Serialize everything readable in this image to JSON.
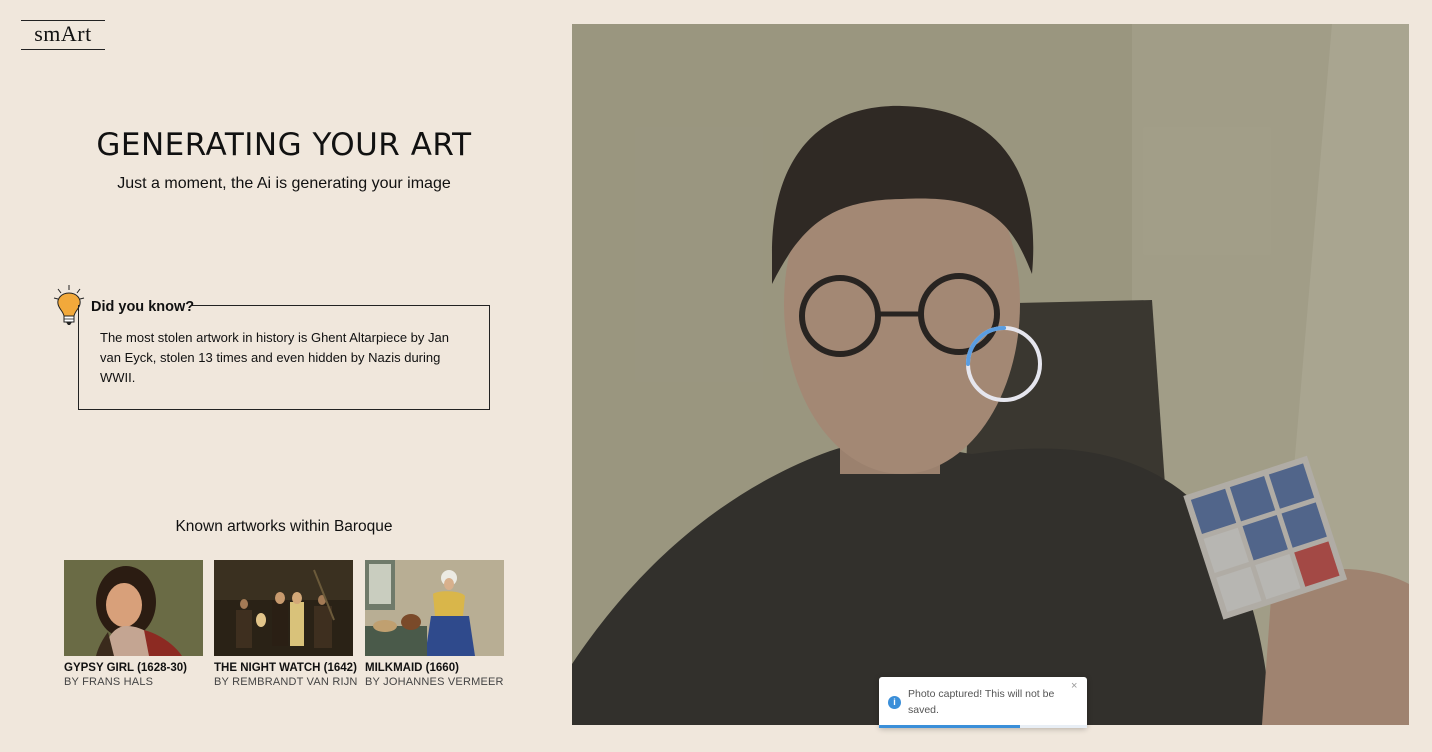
{
  "brand": {
    "logo_text": "smArt"
  },
  "header": {
    "title": "GENERATING YOUR ART",
    "subtitle": "Just a moment, the Ai is generating your image"
  },
  "fact": {
    "heading": "Did you know?",
    "text": "The most stolen artwork in history is Ghent Altarpiece by Jan van Eyck, stolen 13 times and even hidden by Nazis during WWII."
  },
  "known": {
    "title": "Known artworks within Baroque",
    "artworks": [
      {
        "title": "GYPSY GIRL (1628-30)",
        "artist": "BY FRANS HALS"
      },
      {
        "title": "THE NIGHT WATCH (1642)",
        "artist": "BY REMBRANDT VAN RIJN"
      },
      {
        "title": "MILKMAID (1660)",
        "artist": "BY JOHANNES VERMEER"
      }
    ]
  },
  "camera": {
    "spinner_progress": 0.25
  },
  "toast": {
    "message": "Photo captured! This will not be saved.",
    "close": "×",
    "icon": "i",
    "progress": 0.68
  },
  "colors": {
    "background": "#f0e7dc",
    "accent": "#3b8fd9",
    "spinner": "#5b9de0"
  }
}
